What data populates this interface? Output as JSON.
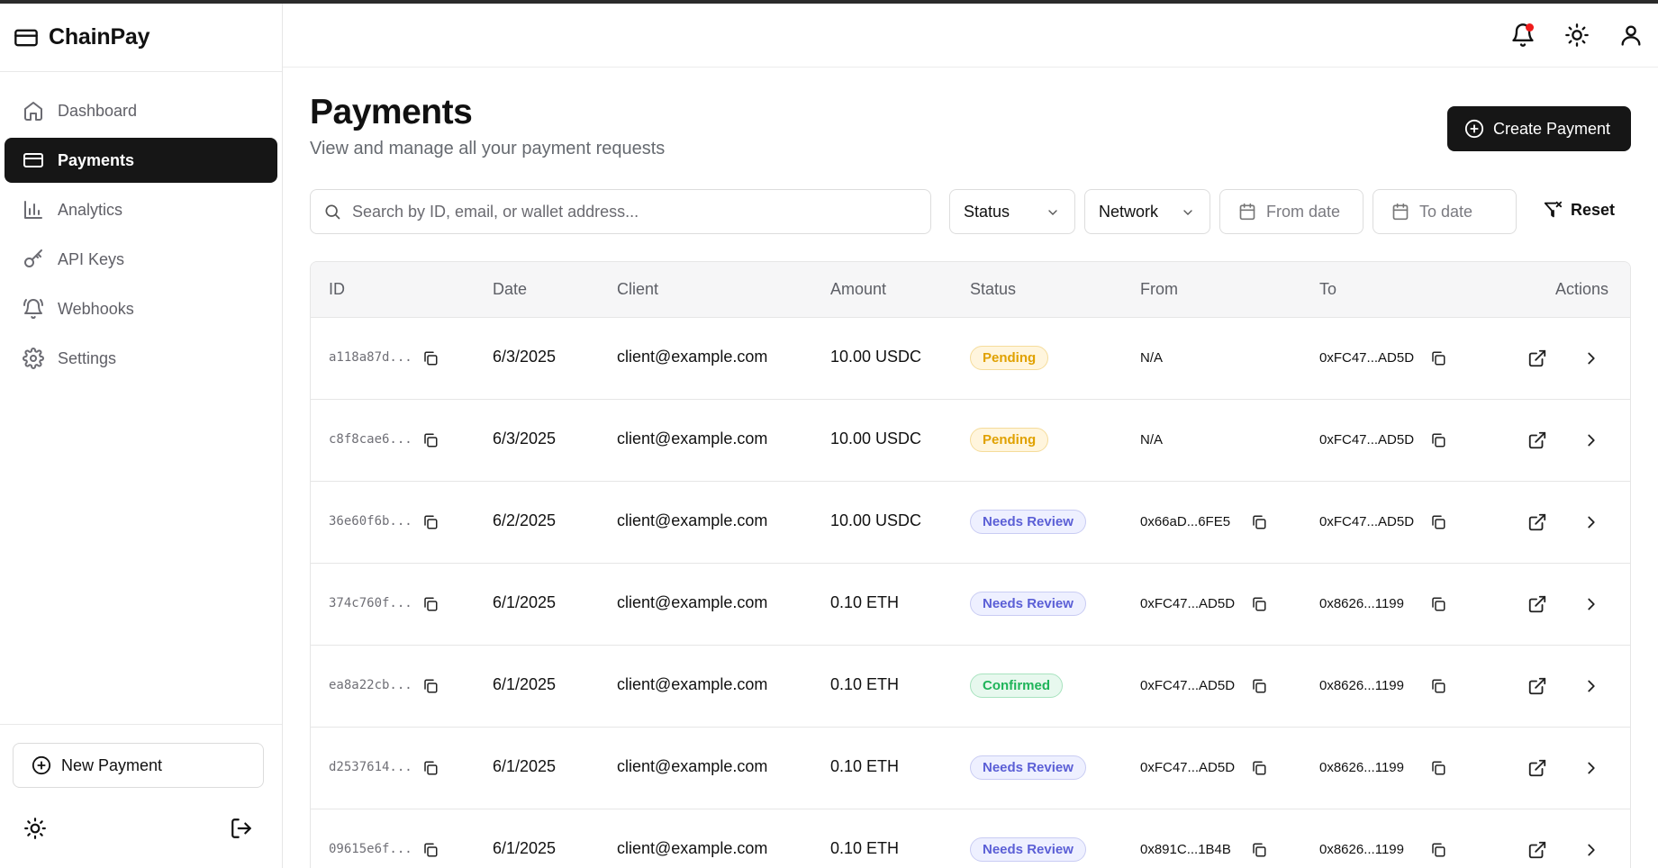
{
  "app": {
    "name": "ChainPay"
  },
  "sidebar": {
    "items": [
      {
        "label": "Dashboard",
        "icon": "home-icon"
      },
      {
        "label": "Payments",
        "icon": "card-icon",
        "active": true
      },
      {
        "label": "Analytics",
        "icon": "bar-chart-icon"
      },
      {
        "label": "API Keys",
        "icon": "key-icon"
      },
      {
        "label": "Webhooks",
        "icon": "bell-ring-icon"
      },
      {
        "label": "Settings",
        "icon": "gear-icon"
      }
    ],
    "new_payment_label": "New Payment"
  },
  "page": {
    "title": "Payments",
    "subtitle": "View and manage all your payment requests",
    "create_button": "Create Payment"
  },
  "filters": {
    "search_placeholder": "Search by ID, email, or wallet address...",
    "status_label": "Status",
    "network_label": "Network",
    "from_date_placeholder": "From date",
    "to_date_placeholder": "To date",
    "reset_label": "Reset"
  },
  "table": {
    "headers": {
      "id": "ID",
      "date": "Date",
      "client": "Client",
      "amount": "Amount",
      "status": "Status",
      "from": "From",
      "to": "To",
      "actions": "Actions"
    },
    "rows": [
      {
        "id": "a118a87d...",
        "date": "6/3/2025",
        "client": "client@example.com",
        "amount": "10.00 USDC",
        "status": "Pending",
        "from": "N/A",
        "to": "0xFC47...AD5D"
      },
      {
        "id": "c8f8cae6...",
        "date": "6/3/2025",
        "client": "client@example.com",
        "amount": "10.00 USDC",
        "status": "Pending",
        "from": "N/A",
        "to": "0xFC47...AD5D"
      },
      {
        "id": "36e60f6b...",
        "date": "6/2/2025",
        "client": "client@example.com",
        "amount": "10.00 USDC",
        "status": "Needs Review",
        "from": "0x66aD...6FE5",
        "to": "0xFC47...AD5D"
      },
      {
        "id": "374c760f...",
        "date": "6/1/2025",
        "client": "client@example.com",
        "amount": "0.10 ETH",
        "status": "Needs Review",
        "from": "0xFC47...AD5D",
        "to": "0x8626...1199"
      },
      {
        "id": "ea8a22cb...",
        "date": "6/1/2025",
        "client": "client@example.com",
        "amount": "0.10 ETH",
        "status": "Confirmed",
        "from": "0xFC47...AD5D",
        "to": "0x8626...1199"
      },
      {
        "id": "d2537614...",
        "date": "6/1/2025",
        "client": "client@example.com",
        "amount": "0.10 ETH",
        "status": "Needs Review",
        "from": "0xFC47...AD5D",
        "to": "0x8626...1199"
      },
      {
        "id": "09615e6f...",
        "date": "6/1/2025",
        "client": "client@example.com",
        "amount": "0.10 ETH",
        "status": "Needs Review",
        "from": "0x891C...1B4B",
        "to": "0x8626...1199"
      }
    ]
  },
  "status_colors": {
    "Pending": {
      "text": "#e0a100",
      "bg": "#fff5dd",
      "border": "#f5dc9b"
    },
    "Needs Review": {
      "text": "#5b5fd6",
      "bg": "#eef0ff",
      "border": "#c9ccf3"
    },
    "Confirmed": {
      "text": "#1fb45a",
      "bg": "#e7f8ee",
      "border": "#a8e3bf"
    }
  },
  "colors": {
    "accent": "#161616",
    "notification_dot": "#ef1b1b"
  }
}
